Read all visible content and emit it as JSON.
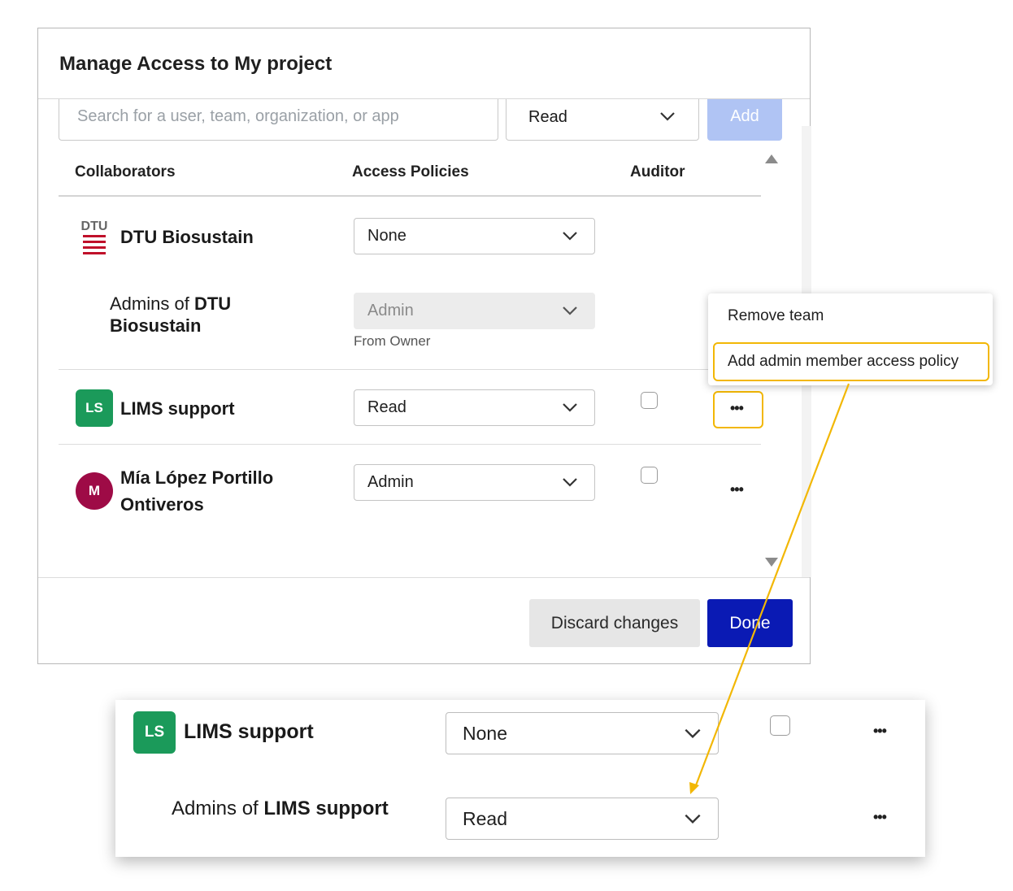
{
  "dialog": {
    "title": "Manage Access to My project",
    "search_placeholder": "Search for a user, team, organization, or app",
    "permission_value": "Read",
    "add_label": "Add",
    "columns": [
      "Collaborators",
      "Access Policies",
      "Auditor"
    ],
    "rows": [
      {
        "name": "DTU Biosustain",
        "logo_text": "DTU",
        "policy": "None"
      },
      {
        "name_prefix": "Admins of ",
        "name_bold": "DTU Biosustain",
        "name_bold_line1": "DTU",
        "name_bold_line2": "Biosustain",
        "policy": "Admin",
        "note": "From Owner"
      },
      {
        "name": "LIMS support",
        "initials": "LS",
        "policy": "Read"
      },
      {
        "name_line1": "Mía López Portillo",
        "name_line2": "Ontiveros",
        "initials": "M",
        "policy": "Admin"
      }
    ],
    "more_icon": "•••",
    "discard_label": "Discard changes",
    "done_label": "Done"
  },
  "context_menu": {
    "items": [
      "Remove team",
      "Add admin member access policy"
    ]
  },
  "zoom_panel": {
    "rows": [
      {
        "name": "LIMS support",
        "initials": "LS",
        "policy": "None"
      },
      {
        "name_prefix": "Admins of ",
        "name_bold": "LIMS support",
        "policy": "Read"
      }
    ]
  },
  "colors": {
    "primary": "#0a1ab4",
    "add_disabled": "#b0c4f4",
    "highlight": "#f2b705",
    "team_badge": "#1b9a5a",
    "avatar": "#9e0b46",
    "dtu_red": "#c0102a"
  }
}
